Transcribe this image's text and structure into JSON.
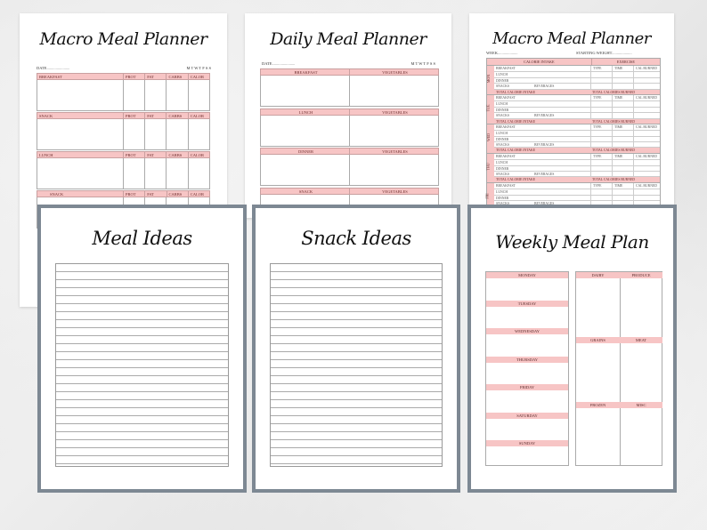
{
  "macro_daily": {
    "title": "Macro Meal Planner",
    "date_label": "DATE",
    "days": "M T W T F S S",
    "meals": [
      "BREAKFAST",
      "SNACK",
      "LUNCH",
      "SNACK"
    ],
    "cols": [
      "PROT",
      "FAT",
      "CARBS",
      "CALOR"
    ]
  },
  "daily": {
    "title": "Daily Meal Planner",
    "date_label": "DATE",
    "days": "M T W T F S S",
    "meals": [
      "BREAKFAST",
      "LUNCH",
      "DINNER",
      "SNACK"
    ],
    "side": "VEGETABLES"
  },
  "macro_week": {
    "title": "Macro Meal Planner",
    "week_label": "WEEK",
    "weight_label": "STARTING WEIGHT",
    "intake": "CALORIE INTAKE",
    "exercise": "EXERCISE",
    "days": [
      "MON",
      "TUE",
      "WED",
      "THU",
      "FRI"
    ],
    "rows": [
      "BREAKFAST",
      "LUNCH",
      "DINNER",
      "SNACKS"
    ],
    "beverages": "BEVERAGES",
    "ex_cols": [
      "TYPE",
      "TIME",
      "CAL BURNED"
    ],
    "total_intake": "TOTAL CALORIE INTAKE",
    "total_burned": "TOTAL CALORIES BURNED"
  },
  "meal_ideas": {
    "title": "Meal Ideas"
  },
  "snack_ideas": {
    "title": "Snack Ideas"
  },
  "weekly": {
    "title": "Weekly Meal Plan",
    "days": [
      "MONDAY",
      "TUESDAY",
      "WEDNESDAY",
      "THURSDAY",
      "FRIDAY",
      "SATURDAY",
      "SUNDAY"
    ],
    "groups": [
      "DAIRY",
      "PRODUCE",
      "GRAINS",
      "MEAT",
      "FROZEN",
      "MISC"
    ]
  },
  "colors": {
    "accent": "#f7c5c5",
    "frame": "#7d8893"
  }
}
